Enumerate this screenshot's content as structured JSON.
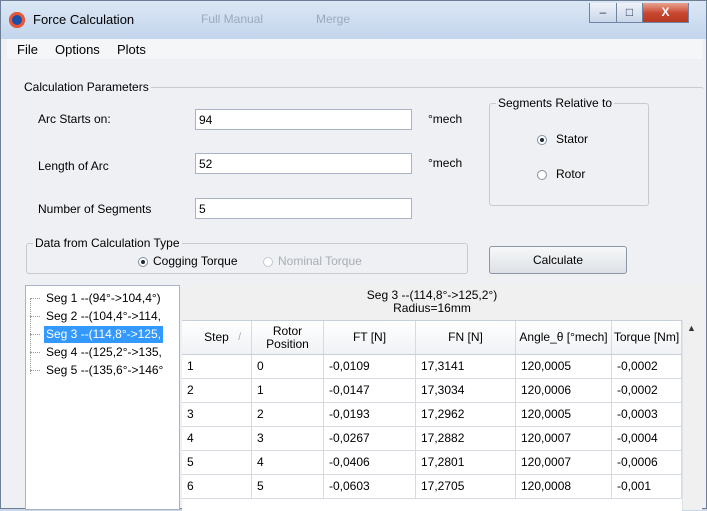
{
  "window": {
    "title": "Force Calculation",
    "background_tabs": [
      "Full Manual",
      "Merge"
    ],
    "controls": {
      "minimize": "–",
      "maximize": "□",
      "close": "X"
    }
  },
  "menu": [
    "File",
    "Options",
    "Plots"
  ],
  "params": {
    "group_title": "Calculation Parameters",
    "arc_start": {
      "label": "Arc Starts on:",
      "value": "94",
      "unit": "°mech"
    },
    "arc_length": {
      "label": "Length of Arc",
      "value": "52",
      "unit": "°mech"
    },
    "segments": {
      "label": "Number of Segments",
      "value": "5"
    },
    "relative": {
      "title": "Segments Relative to",
      "options": [
        "Stator",
        "Rotor"
      ],
      "selected": "Stator"
    },
    "calc_type": {
      "title": "Data from Calculation Type",
      "options": [
        "Cogging Torque",
        "Nominal Torque"
      ],
      "selected": "Cogging Torque"
    },
    "calculate_label": "Calculate"
  },
  "tree": {
    "items": [
      "Seg 1 --(94°->104,4°)",
      "Seg 2 --(104,4°->114,",
      "Seg 3 --(114,8°->125,",
      "Seg 4 --(125,2°->135,",
      "Seg 5 --(135,6°->146°"
    ],
    "selected_index": 2
  },
  "results": {
    "title": "Seg 3 --(114,8°->125,2°)",
    "subtitle": "Radius=16mm",
    "columns": [
      "Step",
      "Rotor Position",
      "FT [N]",
      "FN [N]",
      "Angle_θ [°mech]",
      "Torque [Nm]"
    ],
    "sort_indicator": "/",
    "rows": [
      [
        "1",
        "0",
        "-0,0109",
        "17,3141",
        "120,0005",
        "-0,0002"
      ],
      [
        "2",
        "1",
        "-0,0147",
        "17,3034",
        "120,0006",
        "-0,0002"
      ],
      [
        "3",
        "2",
        "-0,0193",
        "17,2962",
        "120,0005",
        "-0,0003"
      ],
      [
        "4",
        "3",
        "-0,0267",
        "17,2882",
        "120,0007",
        "-0,0004"
      ],
      [
        "5",
        "4",
        "-0,0406",
        "17,2801",
        "120,0007",
        "-0,0006"
      ],
      [
        "6",
        "5",
        "-0,0603",
        "17,2705",
        "120,0008",
        "-0,001"
      ]
    ],
    "scroll_up": "▲"
  }
}
